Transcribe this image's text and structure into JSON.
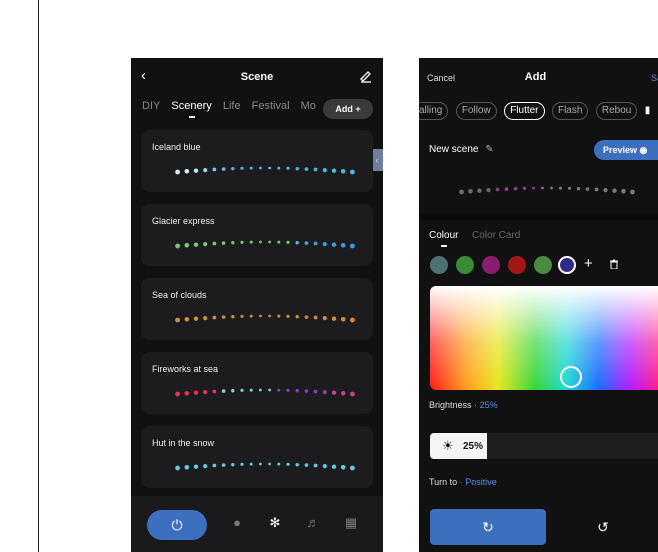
{
  "scene_screen": {
    "title": "Scene",
    "tabs": [
      "DIY",
      "Scenery",
      "Life",
      "Festival",
      "Mo"
    ],
    "active_tab": "Scenery",
    "add_label": "Add +",
    "scenes": [
      {
        "name": "Iceland blue",
        "dots": [
          "#e8e8e8",
          "#d6eef6",
          "#bfe6f2",
          "#8fd6ee",
          "#6ccbe8",
          "#57c2e4",
          "#4bb8dc",
          "#4bb8dc",
          "#4bb8dc",
          "#4bb8dc",
          "#4bb8dc",
          "#4bb8dc",
          "#4bb8dc",
          "#4bb8dc",
          "#4bb8dc",
          "#4bb8dc",
          "#4bb8dc",
          "#4bb8dc",
          "#4bb8dc",
          "#4bb8dc"
        ]
      },
      {
        "name": "Glacier express",
        "dots": [
          "#7bc96f",
          "#7bc96f",
          "#7bc96f",
          "#7bc96f",
          "#7bc96f",
          "#7bc96f",
          "#7bc96f",
          "#7bc96f",
          "#7bc96f",
          "#7bc96f",
          "#7bc96f",
          "#7bc96f",
          "#7bc96f",
          "#5fb8d8",
          "#4aa8e0",
          "#3d9ce6",
          "#3d9ce6",
          "#3d9ce6",
          "#3d9ce6",
          "#3d9ce6"
        ]
      },
      {
        "name": "Sea of clouds",
        "dots": [
          "#d28a3e",
          "#d28a3e",
          "#d28a3e",
          "#d28a3e",
          "#d28a3e",
          "#d28a3e",
          "#d28a3e",
          "#d28a3e",
          "#d28a3e",
          "#d28a3e",
          "#d28a3e",
          "#d28a3e",
          "#d28a3e",
          "#d28a3e",
          "#d28a3e",
          "#d28a3e",
          "#d28a3e",
          "#d28a3e",
          "#d28a3e",
          "#d28a3e"
        ]
      },
      {
        "name": "Fireworks at sea",
        "dots": [
          "#e8324f",
          "#e8324f",
          "#e8324f",
          "#e8324f",
          "#e8324f",
          "#7fd3df",
          "#7fd3df",
          "#7fd3df",
          "#7fd3df",
          "#7fd3df",
          "#7fd3df",
          "#8b3fc6",
          "#8b3fc6",
          "#8b3fc6",
          "#8b3fc6",
          "#8b3fc6",
          "#8b3fc6",
          "#d23a8e",
          "#d23a8e",
          "#d23a8e"
        ]
      },
      {
        "name": "Hut in the snow",
        "dots": [
          "#63c9e4",
          "#63c9e4",
          "#63c9e4",
          "#63c9e4",
          "#63c9e4",
          "#63c9e4",
          "#63c9e4",
          "#63c9e4",
          "#63c9e4",
          "#63c9e4",
          "#63c9e4",
          "#63c9e4",
          "#63c9e4",
          "#63c9e4",
          "#63c9e4",
          "#63c9e4",
          "#63c9e4",
          "#63c9e4",
          "#63c9e4",
          "#63c9e4"
        ]
      }
    ],
    "nav_icons": [
      "power-icon",
      "bulb-icon",
      "palette-icon",
      "music-icon",
      "grid-icon"
    ],
    "accent_color": "#3d6fbf"
  },
  "add_screen": {
    "cancel_label": "Cancel",
    "title": "Add",
    "save_label": "Sa",
    "modes": [
      "alling",
      "Follow",
      "Flutter",
      "Flash",
      "Rebou"
    ],
    "active_mode": "Flutter",
    "new_scene_label": "New scene",
    "preview_label": "Preview",
    "preview_dots": [
      "#6b6b6b",
      "#6b6b6b",
      "#6b6b6b",
      "#6b6b6b",
      "#8b3a8e",
      "#a23d9a",
      "#a23d9a",
      "#a23d9a",
      "#8b3a8e",
      "#7a7a7a",
      "#7a7a7a",
      "#7a7a7a",
      "#7a7a7a",
      "#7a7a7a",
      "#7a7a7a",
      "#7a7a7a",
      "#7a7a7a",
      "#7a7a7a",
      "#7a7a7a",
      "#7a7a7a"
    ],
    "colour_tab": "Colour",
    "color_card_tab": "Color Card",
    "swatches": [
      "#4e6f73",
      "#3b8a35",
      "#8a1d6e",
      "#a31616",
      "#4a8a42",
      "#2f2a8a"
    ],
    "brightness_label": "Brightness",
    "brightness_value": "25%",
    "brightness_level": 0.25,
    "slider_value": "25%",
    "turn_to_label": "Turn to",
    "turn_to_value": "Positive"
  }
}
